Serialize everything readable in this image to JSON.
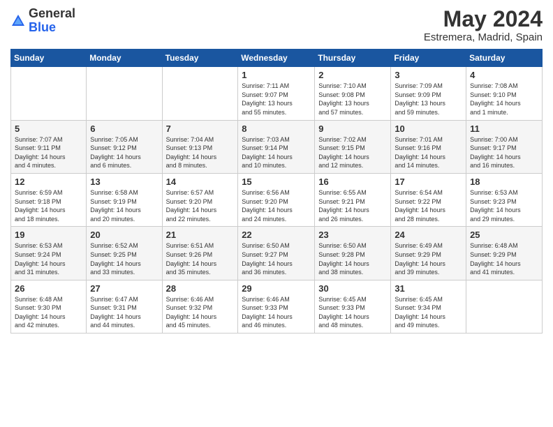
{
  "logo": {
    "general": "General",
    "blue": "Blue"
  },
  "title": {
    "month_year": "May 2024",
    "location": "Estremera, Madrid, Spain"
  },
  "days_of_week": [
    "Sunday",
    "Monday",
    "Tuesday",
    "Wednesday",
    "Thursday",
    "Friday",
    "Saturday"
  ],
  "weeks": [
    [
      {
        "day": "",
        "info": ""
      },
      {
        "day": "",
        "info": ""
      },
      {
        "day": "",
        "info": ""
      },
      {
        "day": "1",
        "info": "Sunrise: 7:11 AM\nSunset: 9:07 PM\nDaylight: 13 hours\nand 55 minutes."
      },
      {
        "day": "2",
        "info": "Sunrise: 7:10 AM\nSunset: 9:08 PM\nDaylight: 13 hours\nand 57 minutes."
      },
      {
        "day": "3",
        "info": "Sunrise: 7:09 AM\nSunset: 9:09 PM\nDaylight: 13 hours\nand 59 minutes."
      },
      {
        "day": "4",
        "info": "Sunrise: 7:08 AM\nSunset: 9:10 PM\nDaylight: 14 hours\nand 1 minute."
      }
    ],
    [
      {
        "day": "5",
        "info": "Sunrise: 7:07 AM\nSunset: 9:11 PM\nDaylight: 14 hours\nand 4 minutes."
      },
      {
        "day": "6",
        "info": "Sunrise: 7:05 AM\nSunset: 9:12 PM\nDaylight: 14 hours\nand 6 minutes."
      },
      {
        "day": "7",
        "info": "Sunrise: 7:04 AM\nSunset: 9:13 PM\nDaylight: 14 hours\nand 8 minutes."
      },
      {
        "day": "8",
        "info": "Sunrise: 7:03 AM\nSunset: 9:14 PM\nDaylight: 14 hours\nand 10 minutes."
      },
      {
        "day": "9",
        "info": "Sunrise: 7:02 AM\nSunset: 9:15 PM\nDaylight: 14 hours\nand 12 minutes."
      },
      {
        "day": "10",
        "info": "Sunrise: 7:01 AM\nSunset: 9:16 PM\nDaylight: 14 hours\nand 14 minutes."
      },
      {
        "day": "11",
        "info": "Sunrise: 7:00 AM\nSunset: 9:17 PM\nDaylight: 14 hours\nand 16 minutes."
      }
    ],
    [
      {
        "day": "12",
        "info": "Sunrise: 6:59 AM\nSunset: 9:18 PM\nDaylight: 14 hours\nand 18 minutes."
      },
      {
        "day": "13",
        "info": "Sunrise: 6:58 AM\nSunset: 9:19 PM\nDaylight: 14 hours\nand 20 minutes."
      },
      {
        "day": "14",
        "info": "Sunrise: 6:57 AM\nSunset: 9:20 PM\nDaylight: 14 hours\nand 22 minutes."
      },
      {
        "day": "15",
        "info": "Sunrise: 6:56 AM\nSunset: 9:20 PM\nDaylight: 14 hours\nand 24 minutes."
      },
      {
        "day": "16",
        "info": "Sunrise: 6:55 AM\nSunset: 9:21 PM\nDaylight: 14 hours\nand 26 minutes."
      },
      {
        "day": "17",
        "info": "Sunrise: 6:54 AM\nSunset: 9:22 PM\nDaylight: 14 hours\nand 28 minutes."
      },
      {
        "day": "18",
        "info": "Sunrise: 6:53 AM\nSunset: 9:23 PM\nDaylight: 14 hours\nand 29 minutes."
      }
    ],
    [
      {
        "day": "19",
        "info": "Sunrise: 6:53 AM\nSunset: 9:24 PM\nDaylight: 14 hours\nand 31 minutes."
      },
      {
        "day": "20",
        "info": "Sunrise: 6:52 AM\nSunset: 9:25 PM\nDaylight: 14 hours\nand 33 minutes."
      },
      {
        "day": "21",
        "info": "Sunrise: 6:51 AM\nSunset: 9:26 PM\nDaylight: 14 hours\nand 35 minutes."
      },
      {
        "day": "22",
        "info": "Sunrise: 6:50 AM\nSunset: 9:27 PM\nDaylight: 14 hours\nand 36 minutes."
      },
      {
        "day": "23",
        "info": "Sunrise: 6:50 AM\nSunset: 9:28 PM\nDaylight: 14 hours\nand 38 minutes."
      },
      {
        "day": "24",
        "info": "Sunrise: 6:49 AM\nSunset: 9:29 PM\nDaylight: 14 hours\nand 39 minutes."
      },
      {
        "day": "25",
        "info": "Sunrise: 6:48 AM\nSunset: 9:29 PM\nDaylight: 14 hours\nand 41 minutes."
      }
    ],
    [
      {
        "day": "26",
        "info": "Sunrise: 6:48 AM\nSunset: 9:30 PM\nDaylight: 14 hours\nand 42 minutes."
      },
      {
        "day": "27",
        "info": "Sunrise: 6:47 AM\nSunset: 9:31 PM\nDaylight: 14 hours\nand 44 minutes."
      },
      {
        "day": "28",
        "info": "Sunrise: 6:46 AM\nSunset: 9:32 PM\nDaylight: 14 hours\nand 45 minutes."
      },
      {
        "day": "29",
        "info": "Sunrise: 6:46 AM\nSunset: 9:33 PM\nDaylight: 14 hours\nand 46 minutes."
      },
      {
        "day": "30",
        "info": "Sunrise: 6:45 AM\nSunset: 9:33 PM\nDaylight: 14 hours\nand 48 minutes."
      },
      {
        "day": "31",
        "info": "Sunrise: 6:45 AM\nSunset: 9:34 PM\nDaylight: 14 hours\nand 49 minutes."
      },
      {
        "day": "",
        "info": ""
      }
    ]
  ]
}
